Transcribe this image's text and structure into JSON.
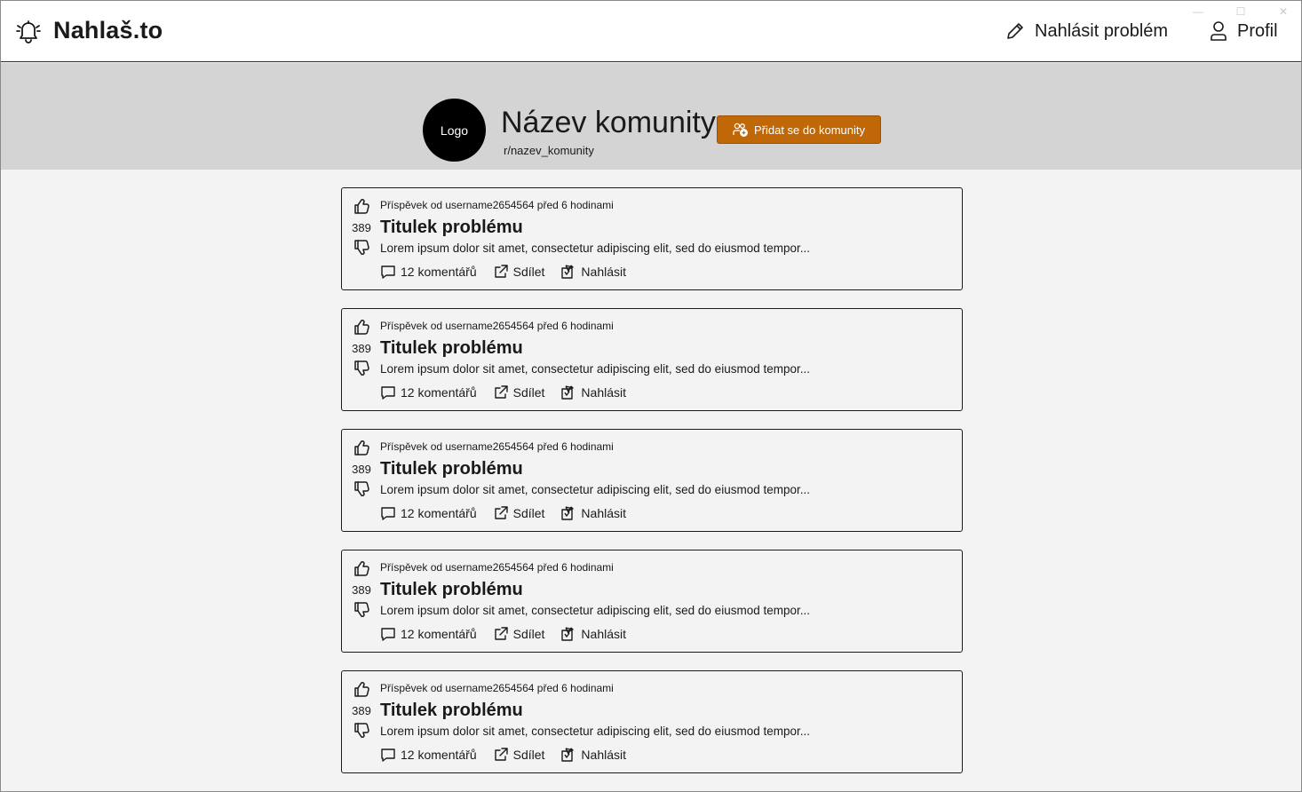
{
  "window_controls": {
    "minimize": "—",
    "maximize": "☐",
    "close": "✕"
  },
  "header": {
    "brand": "Nahlaš.to",
    "brand_icon": "bell-icon",
    "report_label": "Nahlásit problém",
    "report_icon": "pencil-icon",
    "profile_label": "Profil",
    "profile_icon": "person-icon"
  },
  "community": {
    "logo_text": "Logo",
    "name": "Název komunity",
    "slug": "r/nazev_komunity",
    "join_label": "Přidat se do komunity",
    "join_icon": "people-add-icon",
    "accent_color": "#c06707"
  },
  "posts": [
    {
      "meta": "Příspěvek od username2654564 před 6 hodinami",
      "score": "389",
      "title": "Titulek problému",
      "excerpt": "Lorem ipsum dolor sit amet, consectetur adipiscing elit, sed do eiusmod tempor...",
      "comments": "12 komentářů",
      "share": "Sdílet",
      "report": "Nahlásit"
    },
    {
      "meta": "Příspěvek od username2654564 před 6 hodinami",
      "score": "389",
      "title": "Titulek problému",
      "excerpt": "Lorem ipsum dolor sit amet, consectetur adipiscing elit, sed do eiusmod tempor...",
      "comments": "12 komentářů",
      "share": "Sdílet",
      "report": "Nahlásit"
    },
    {
      "meta": "Příspěvek od username2654564 před 6 hodinami",
      "score": "389",
      "title": "Titulek problému",
      "excerpt": "Lorem ipsum dolor sit amet, consectetur adipiscing elit, sed do eiusmod tempor...",
      "comments": "12 komentářů",
      "share": "Sdílet",
      "report": "Nahlásit"
    },
    {
      "meta": "Příspěvek od username2654564 před 6 hodinami",
      "score": "389",
      "title": "Titulek problému",
      "excerpt": "Lorem ipsum dolor sit amet, consectetur adipiscing elit, sed do eiusmod tempor...",
      "comments": "12 komentářů",
      "share": "Sdílet",
      "report": "Nahlásit"
    },
    {
      "meta": "Příspěvek od username2654564 před 6 hodinami",
      "score": "389",
      "title": "Titulek problému",
      "excerpt": "Lorem ipsum dolor sit amet, consectetur adipiscing elit, sed do eiusmod tempor...",
      "comments": "12 komentářů",
      "share": "Sdílet",
      "report": "Nahlásit"
    }
  ]
}
